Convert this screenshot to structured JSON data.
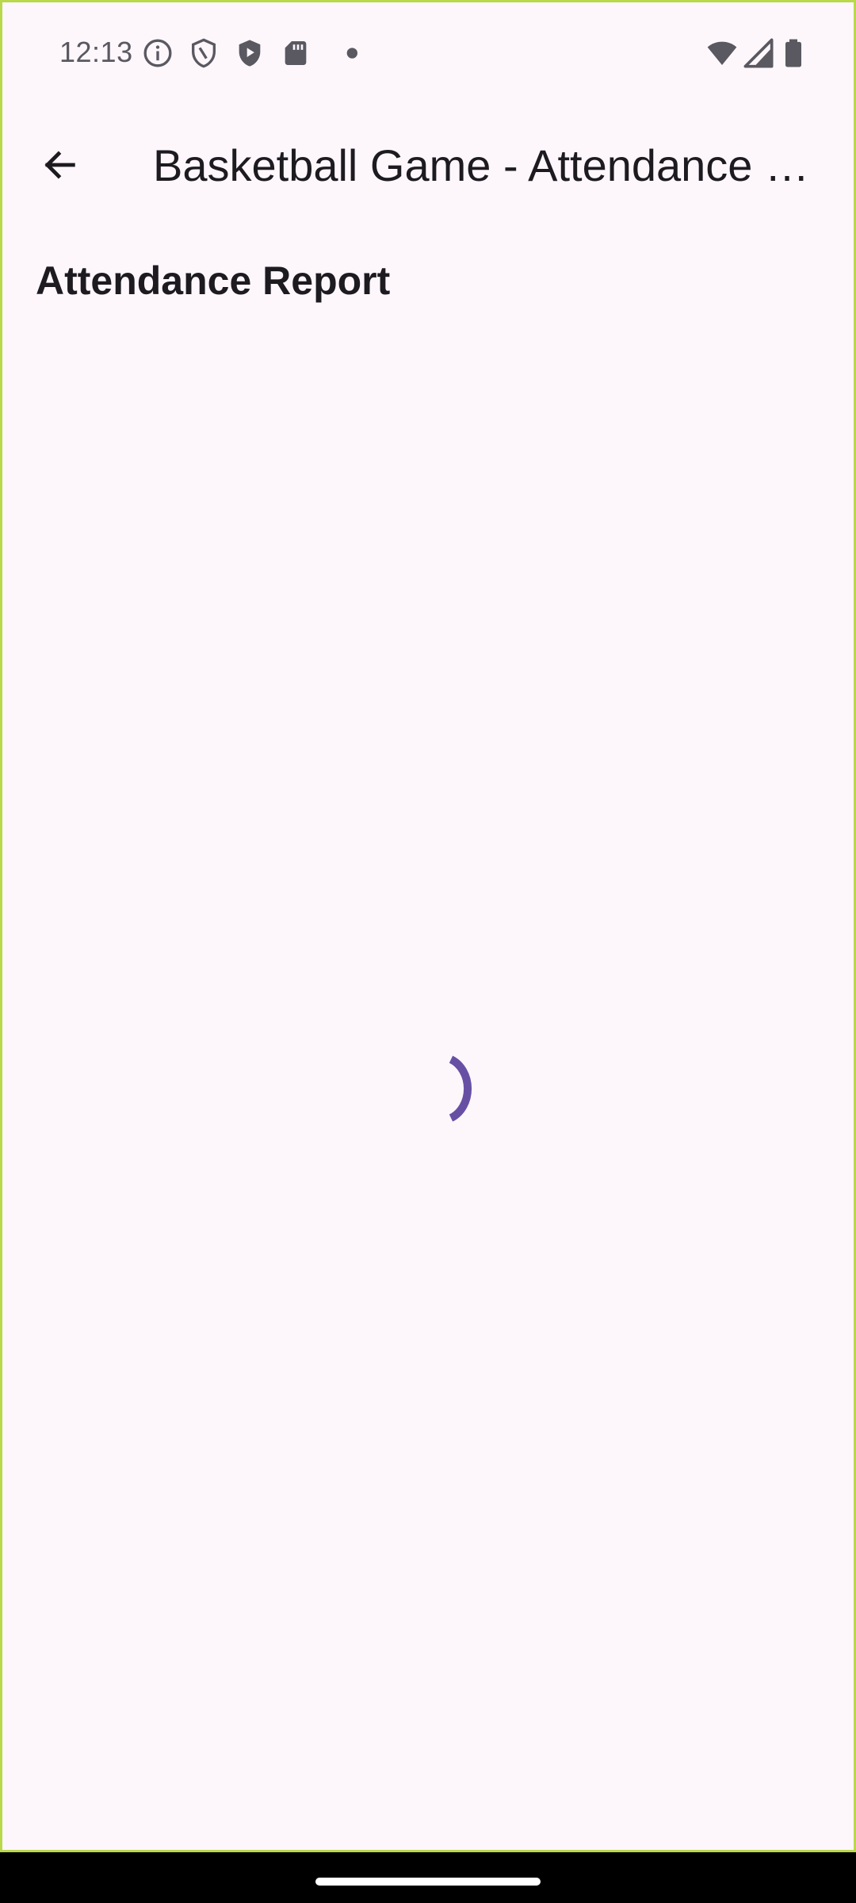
{
  "status_bar": {
    "time": "12:13",
    "icons": [
      "info-icon",
      "shield-outline-icon",
      "play-shield-icon",
      "sd-card-icon",
      "dot-icon",
      "wifi-icon",
      "signal-icon",
      "battery-icon"
    ]
  },
  "app_bar": {
    "back_icon": "arrow-back-icon",
    "title": "Basketball Game - Attendance Report"
  },
  "content": {
    "heading": "Attendance Report",
    "loading_indicator": "progress-spinner"
  },
  "colors": {
    "background": "#FDF7FC",
    "text": "#1D1B20",
    "accent": "#6750A4",
    "status_icon": "#5A5860"
  }
}
